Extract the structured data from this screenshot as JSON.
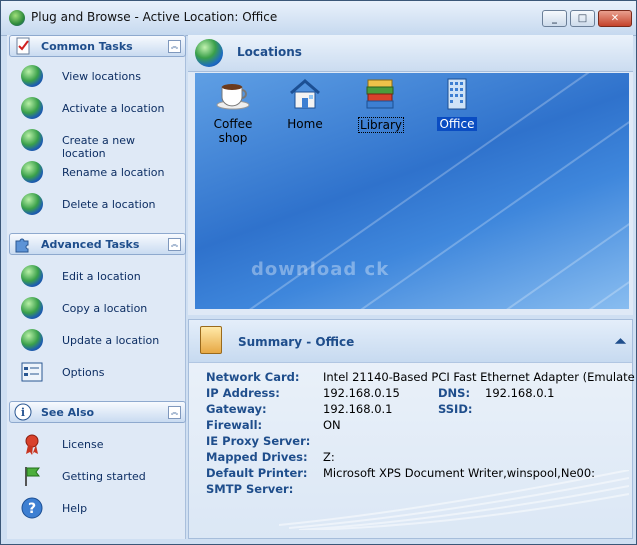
{
  "window": {
    "title": "Plug and Browse - Active Location: Office",
    "min_label": "_",
    "max_label": "□",
    "close_label": "✕"
  },
  "sidebar": {
    "groups": [
      {
        "title": "Common Tasks",
        "icon": "checklist-icon",
        "tasks": [
          {
            "label": "View locations",
            "icon": "magnifier-globe-icon"
          },
          {
            "label": "Activate a location",
            "icon": "arrow-globe-icon"
          },
          {
            "label": "Create a new location",
            "icon": "new-globe-icon"
          },
          {
            "label": "Rename a location",
            "icon": "rename-globe-icon"
          },
          {
            "label": "Delete a location",
            "icon": "delete-globe-icon"
          }
        ]
      },
      {
        "title": "Advanced Tasks",
        "icon": "puzzle-icon",
        "tasks": [
          {
            "label": "Edit a location",
            "icon": "edit-globe-icon"
          },
          {
            "label": "Copy a location",
            "icon": "copy-globe-icon"
          },
          {
            "label": "Update a location",
            "icon": "clock-globe-icon"
          },
          {
            "label": "Options",
            "icon": "options-icon"
          }
        ]
      },
      {
        "title": "See Also",
        "icon": "info-icon",
        "tasks": [
          {
            "label": "License",
            "icon": "ribbon-icon"
          },
          {
            "label": "Getting started",
            "icon": "flag-icon"
          },
          {
            "label": "Help",
            "icon": "help-icon"
          }
        ]
      }
    ]
  },
  "locations": {
    "title": "Locations",
    "items": [
      {
        "label": "Coffee shop",
        "icon": "coffee-cup-icon"
      },
      {
        "label": "Home",
        "icon": "house-icon"
      },
      {
        "label": "Library",
        "icon": "books-icon"
      },
      {
        "label": "Office",
        "icon": "office-building-icon"
      }
    ],
    "watermark": "download ck"
  },
  "summary": {
    "title": "Summary - Office",
    "rows": [
      {
        "k": "Network Card:",
        "v": "Intel 21140-Based PCI Fast Ethernet Adapter (Emulate"
      },
      {
        "k": "IP Address:",
        "v": "192.168.0.15",
        "k2": "DNS:",
        "v2": "192.168.0.1"
      },
      {
        "k": "Gateway:",
        "v": "192.168.0.1",
        "k2": "SSID:",
        "v2": ""
      },
      {
        "k": "Firewall:",
        "v": "ON"
      },
      {
        "k": "IE Proxy Server:",
        "v": ""
      },
      {
        "k": "Mapped Drives:",
        "v": "Z:"
      },
      {
        "k": "Default Printer:",
        "v": "Microsoft XPS Document Writer,winspool,Ne00:"
      },
      {
        "k": "SMTP Server:",
        "v": ""
      }
    ]
  },
  "colors": {
    "header_text": "#1f4e8c",
    "selection": "#0a4cc2",
    "background": "#2f72cc"
  }
}
